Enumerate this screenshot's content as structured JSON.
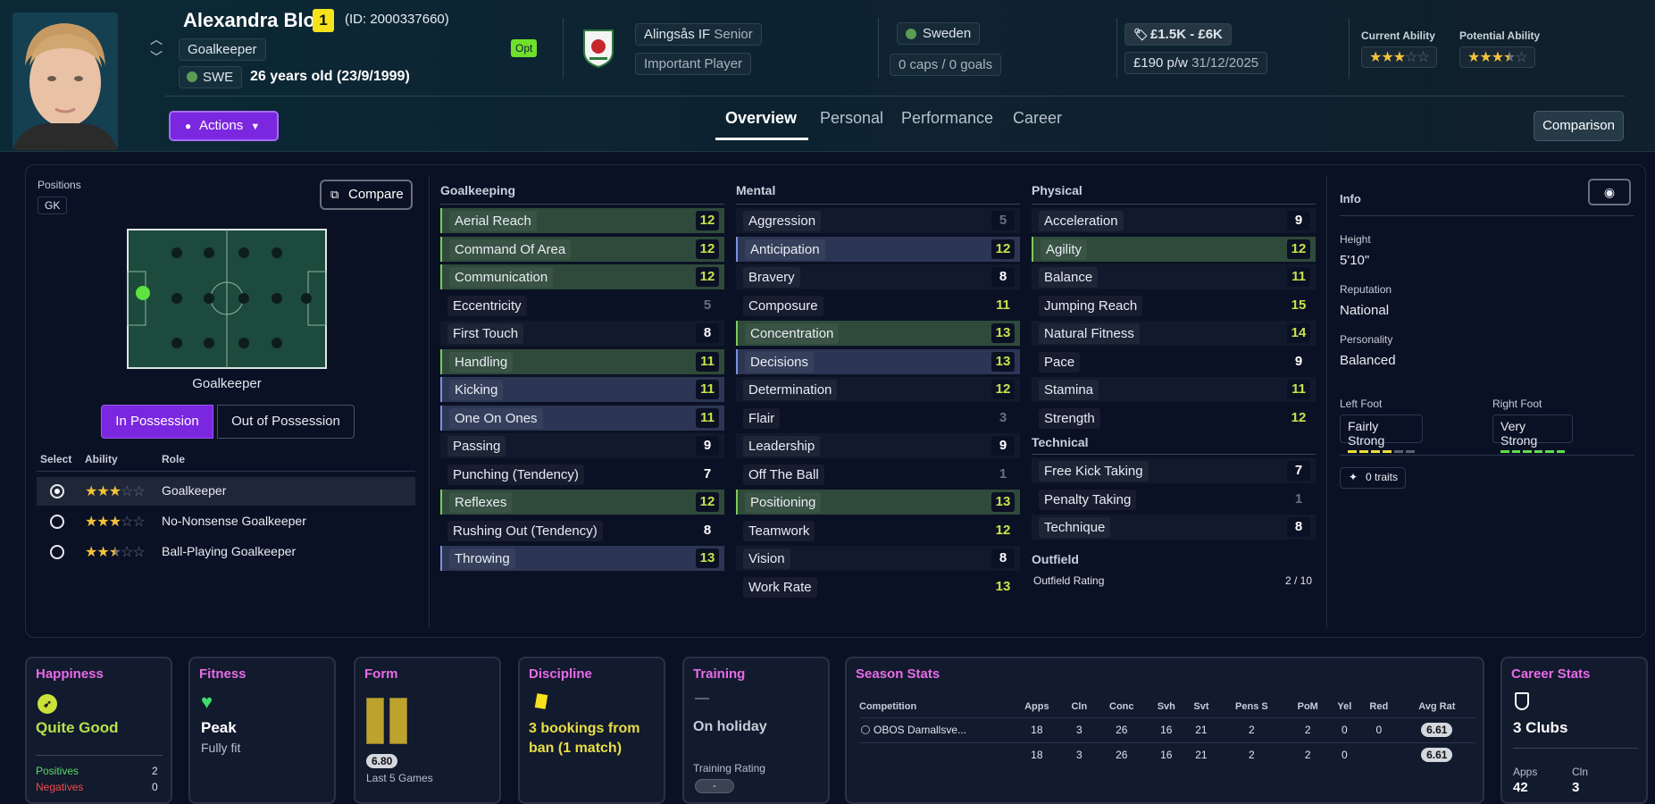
{
  "header": {
    "name": "Alexandra Blom",
    "squad_number": "1",
    "id_text": "(ID: 2000337660)",
    "position": "Goalkeeper",
    "nation_code": "SWE",
    "age_text": "26 years old (23/9/1999)",
    "opt_badge": "Opt",
    "club": "Alingsås IF",
    "club_level": "Senior",
    "squad_status": "Important Player",
    "nation": "Sweden",
    "caps_goals": "0 caps / 0 goals",
    "value_range": "£1.5K - £6K",
    "wage": "£190 p/w",
    "contract_end": "31/12/2025",
    "current_ability_label": "Current Ability",
    "potential_ability_label": "Potential Ability",
    "current_ability_stars": 3,
    "potential_ability_stars": 3.5,
    "actions_label": "Actions",
    "comparison_label": "Comparison",
    "tabs": [
      "Overview",
      "Personal",
      "Performance",
      "Career"
    ],
    "active_tab": "Overview"
  },
  "positions": {
    "label": "Positions",
    "badge": "GK",
    "compare_label": "Compare",
    "pitch_caption": "Goalkeeper",
    "in_possession": "In Possession",
    "out_of_possession": "Out of Possession",
    "col_select": "Select",
    "col_ability": "Ability",
    "col_role": "Role",
    "roles": [
      {
        "name": "Goalkeeper",
        "stars": 3,
        "selected": true
      },
      {
        "name": "No-Nonsense Goalkeeper",
        "stars": 3,
        "selected": false
      },
      {
        "name": "Ball-Playing Goalkeeper",
        "stars": 2.5,
        "selected": false
      }
    ]
  },
  "attributes": {
    "goalkeeping_title": "Goalkeeping",
    "goalkeeping": [
      {
        "name": "Aerial Reach",
        "value": "12",
        "hl": "green"
      },
      {
        "name": "Command Of Area",
        "value": "12",
        "hl": "green"
      },
      {
        "name": "Communication",
        "value": "12",
        "hl": "green"
      },
      {
        "name": "Eccentricity",
        "value": "5",
        "hl": ""
      },
      {
        "name": "First Touch",
        "value": "8",
        "hl": ""
      },
      {
        "name": "Handling",
        "value": "11",
        "hl": "green"
      },
      {
        "name": "Kicking",
        "value": "11",
        "hl": "blue"
      },
      {
        "name": "One On Ones",
        "value": "11",
        "hl": "blue"
      },
      {
        "name": "Passing",
        "value": "9",
        "hl": ""
      },
      {
        "name": "Punching (Tendency)",
        "value": "7",
        "hl": ""
      },
      {
        "name": "Reflexes",
        "value": "12",
        "hl": "green"
      },
      {
        "name": "Rushing Out (Tendency)",
        "value": "8",
        "hl": ""
      },
      {
        "name": "Throwing",
        "value": "13",
        "hl": "blue"
      }
    ],
    "mental_title": "Mental",
    "mental": [
      {
        "name": "Aggression",
        "value": "5",
        "hl": ""
      },
      {
        "name": "Anticipation",
        "value": "12",
        "hl": "blue"
      },
      {
        "name": "Bravery",
        "value": "8",
        "hl": ""
      },
      {
        "name": "Composure",
        "value": "11",
        "hl": ""
      },
      {
        "name": "Concentration",
        "value": "13",
        "hl": "green"
      },
      {
        "name": "Decisions",
        "value": "13",
        "hl": "blue"
      },
      {
        "name": "Determination",
        "value": "12",
        "hl": ""
      },
      {
        "name": "Flair",
        "value": "3",
        "hl": ""
      },
      {
        "name": "Leadership",
        "value": "9",
        "hl": ""
      },
      {
        "name": "Off The Ball",
        "value": "1",
        "hl": ""
      },
      {
        "name": "Positioning",
        "value": "13",
        "hl": "green"
      },
      {
        "name": "Teamwork",
        "value": "12",
        "hl": ""
      },
      {
        "name": "Vision",
        "value": "8",
        "hl": ""
      },
      {
        "name": "Work Rate",
        "value": "13",
        "hl": ""
      }
    ],
    "physical_title": "Physical",
    "physical": [
      {
        "name": "Acceleration",
        "value": "9",
        "hl": ""
      },
      {
        "name": "Agility",
        "value": "12",
        "hl": "green"
      },
      {
        "name": "Balance",
        "value": "11",
        "hl": ""
      },
      {
        "name": "Jumping Reach",
        "value": "15",
        "hl": ""
      },
      {
        "name": "Natural Fitness",
        "value": "14",
        "hl": ""
      },
      {
        "name": "Pace",
        "value": "9",
        "hl": ""
      },
      {
        "name": "Stamina",
        "value": "11",
        "hl": ""
      },
      {
        "name": "Strength",
        "value": "12",
        "hl": ""
      }
    ],
    "technical_title": "Technical",
    "technical": [
      {
        "name": "Free Kick Taking",
        "value": "7",
        "hl": ""
      },
      {
        "name": "Penalty Taking",
        "value": "1",
        "hl": ""
      },
      {
        "name": "Technique",
        "value": "8",
        "hl": ""
      }
    ],
    "outfield_title": "Outfield",
    "outfield_label": "Outfield Rating",
    "outfield_value": "2 / 10"
  },
  "info": {
    "title": "Info",
    "height_label": "Height",
    "height": "5'10\"",
    "reputation_label": "Reputation",
    "reputation": "National",
    "personality_label": "Personality",
    "personality": "Balanced",
    "left_foot_label": "Left Foot",
    "left_foot": "Fairly Strong",
    "left_foot_level": 4,
    "right_foot_label": "Right Foot",
    "right_foot": "Very Strong",
    "right_foot_level": 6,
    "traits": "0 traits"
  },
  "cards": {
    "happiness": {
      "title": "Happiness",
      "value": "Quite Good",
      "positives_label": "Positives",
      "positives": "2",
      "negatives_label": "Negatives",
      "negatives": "0"
    },
    "fitness": {
      "title": "Fitness",
      "value": "Peak",
      "sub": "Fully fit"
    },
    "form": {
      "title": "Form",
      "rating": "6.80",
      "sub": "Last 5 Games"
    },
    "discipline": {
      "title": "Discipline",
      "value": "3 bookings from ban (1 match)"
    },
    "training": {
      "title": "Training",
      "dash": "—",
      "value": "On holiday",
      "rating_label": "Training Rating",
      "rating": "-"
    },
    "season": {
      "title": "Season Stats",
      "headers": [
        "Competition",
        "Apps",
        "Cln",
        "Conc",
        "Svh",
        "Svt",
        "Pens S",
        "PoM",
        "Yel",
        "Red",
        "Avg Rat"
      ],
      "rows": [
        [
          "OBOS Damallsve...",
          "18",
          "3",
          "26",
          "16",
          "21",
          "2",
          "2",
          "0",
          "0",
          "6.61"
        ],
        [
          "",
          "18",
          "3",
          "26",
          "16",
          "21",
          "2",
          "2",
          "0",
          "",
          "6.61"
        ]
      ]
    },
    "career": {
      "title": "Career Stats",
      "value": "3 Clubs",
      "apps_label": "Apps",
      "apps": "42",
      "cln_label": "Cln",
      "cln": "3"
    }
  },
  "colors": {
    "purple": "#8a2be2",
    "green_value": "#c8e34a",
    "highlight_green": "#2f4a3a",
    "highlight_blue": "#2c3654",
    "card_title": "#e86be8"
  }
}
